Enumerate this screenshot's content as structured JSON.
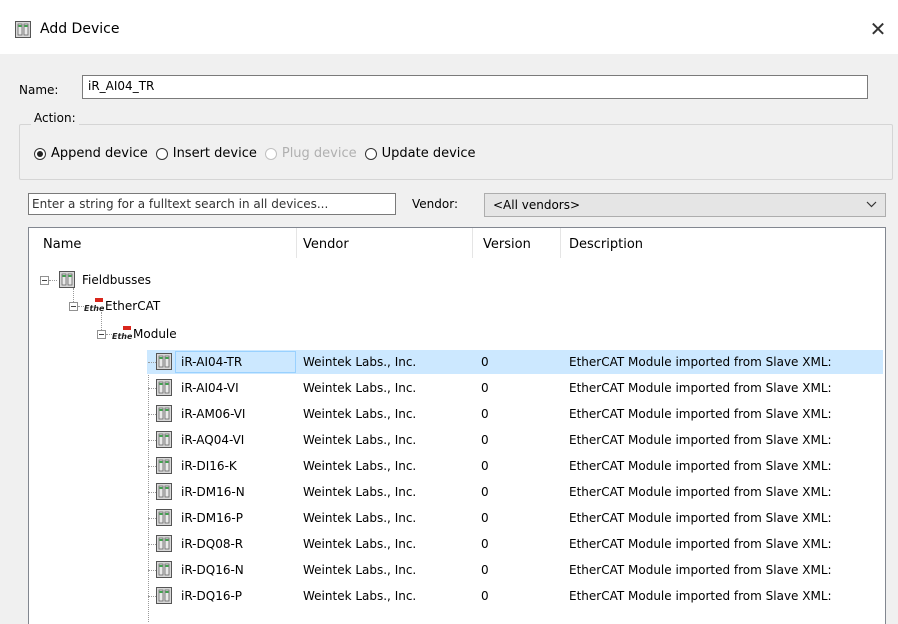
{
  "dialog": {
    "title": "Add Device",
    "close_symbol": "✕"
  },
  "name_field": {
    "label": "Name:",
    "value": "iR_AI04_TR"
  },
  "action": {
    "legend": "Action:",
    "options": [
      {
        "label": "Append device",
        "checked": true,
        "disabled": false
      },
      {
        "label": "Insert device",
        "checked": false,
        "disabled": false
      },
      {
        "label": "Plug device",
        "checked": false,
        "disabled": true
      },
      {
        "label": "Update device",
        "checked": false,
        "disabled": false
      }
    ]
  },
  "search": {
    "placeholder": "Enter a string for a fulltext search in all devices...",
    "vendor_label": "Vendor:",
    "vendor_value": "<All vendors>"
  },
  "columns": [
    "Name",
    "Vendor",
    "Version",
    "Description"
  ],
  "tree": {
    "fieldbusses": "Fieldbusses",
    "ethercat": "EtherCAT",
    "module": "Module",
    "ecat_icon_text": "EtherCAT"
  },
  "devices": [
    {
      "name": "iR-AI04-TR",
      "vendor": "Weintek Labs., Inc.",
      "version": "0",
      "description": "EtherCAT Module imported from Slave XML:"
    },
    {
      "name": "iR-AI04-VI",
      "vendor": "Weintek Labs., Inc.",
      "version": "0",
      "description": "EtherCAT Module imported from Slave XML:"
    },
    {
      "name": "iR-AM06-VI",
      "vendor": "Weintek Labs., Inc.",
      "version": "0",
      "description": "EtherCAT Module imported from Slave XML:"
    },
    {
      "name": "iR-AQ04-VI",
      "vendor": "Weintek Labs., Inc.",
      "version": "0",
      "description": "EtherCAT Module imported from Slave XML:"
    },
    {
      "name": "iR-DI16-K",
      "vendor": "Weintek Labs., Inc.",
      "version": "0",
      "description": "EtherCAT Module imported from Slave XML:"
    },
    {
      "name": "iR-DM16-N",
      "vendor": "Weintek Labs., Inc.",
      "version": "0",
      "description": "EtherCAT Module imported from Slave XML:"
    },
    {
      "name": "iR-DM16-P",
      "vendor": "Weintek Labs., Inc.",
      "version": "0",
      "description": "EtherCAT Module imported from Slave XML:"
    },
    {
      "name": "iR-DQ08-R",
      "vendor": "Weintek Labs., Inc.",
      "version": "0",
      "description": "EtherCAT Module imported from Slave XML:"
    },
    {
      "name": "iR-DQ16-N",
      "vendor": "Weintek Labs., Inc.",
      "version": "0",
      "description": "EtherCAT Module imported from Slave XML:"
    },
    {
      "name": "iR-DQ16-P",
      "vendor": "Weintek Labs., Inc.",
      "version": "0",
      "description": "EtherCAT Module imported from Slave XML:"
    }
  ],
  "colors": {
    "selection": "#cce8ff",
    "selection_border": "#99d1ff",
    "panel_bg": "#f0f0f0"
  }
}
